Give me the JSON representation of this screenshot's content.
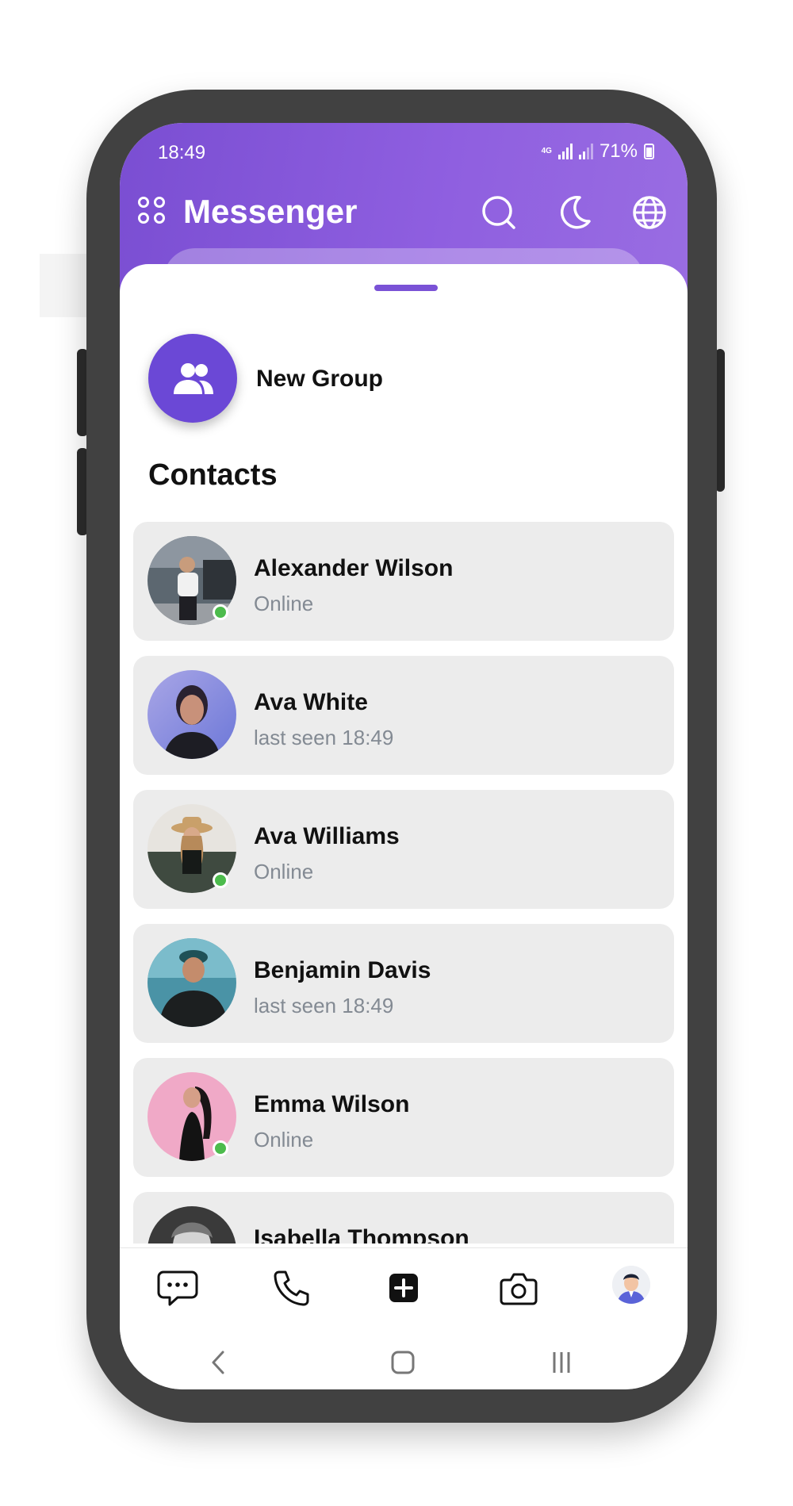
{
  "status_bar": {
    "time": "18:49",
    "network": "4G",
    "battery": "71%"
  },
  "header": {
    "title": "Messenger",
    "icons": [
      "apps-icon",
      "search-icon",
      "moon-icon",
      "globe-icon"
    ]
  },
  "new_group": {
    "label": "New Group",
    "icon": "people-icon"
  },
  "contacts": {
    "heading": "Contacts",
    "items": [
      {
        "name": "Alexander Wilson",
        "status": "Online",
        "online": true
      },
      {
        "name": "Ava White",
        "status": "last seen 18:49",
        "online": false
      },
      {
        "name": "Ava Williams",
        "status": "Online",
        "online": true
      },
      {
        "name": "Benjamin Davis",
        "status": "last seen 18:49",
        "online": false
      },
      {
        "name": "Emma Wilson",
        "status": "Online",
        "online": true
      },
      {
        "name": "Isabella Thompson",
        "status": "",
        "online": false
      }
    ]
  },
  "bottom_nav": {
    "items": [
      "chat-icon",
      "phone-icon",
      "add-icon",
      "camera-icon",
      "profile-avatar"
    ]
  },
  "system_nav": [
    "back-icon",
    "home-icon",
    "recents-icon"
  ],
  "colors": {
    "accent": "#7a52d6",
    "header_start": "#7a4ed2",
    "header_end": "#9a6ee2",
    "online": "#4cbb4c",
    "card_bg": "#ececec",
    "status_text": "#838a93"
  }
}
